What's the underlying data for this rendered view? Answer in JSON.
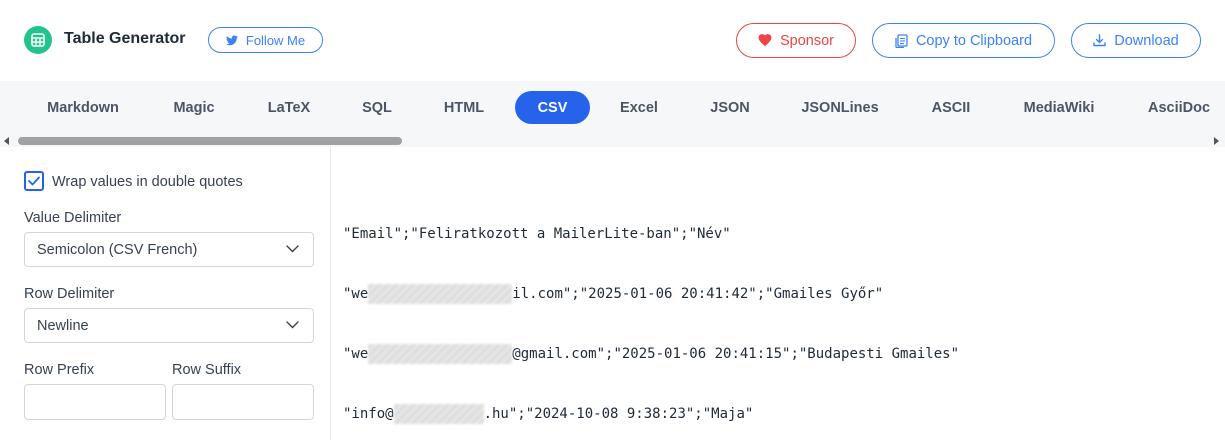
{
  "header": {
    "app_title": "Table Generator",
    "follow_label": "Follow Me",
    "sponsor_label": "Sponsor",
    "copy_label": "Copy to Clipboard",
    "download_label": "Download"
  },
  "tabs": [
    {
      "label": "Markdown"
    },
    {
      "label": "Magic"
    },
    {
      "label": "LaTeX"
    },
    {
      "label": "SQL"
    },
    {
      "label": "HTML"
    },
    {
      "label": "CSV",
      "active": true
    },
    {
      "label": "Excel"
    },
    {
      "label": "JSON"
    },
    {
      "label": "JSONLines"
    },
    {
      "label": "ASCII"
    },
    {
      "label": "MediaWiki"
    },
    {
      "label": "AsciiDoc"
    }
  ],
  "options": {
    "wrap_quotes_label": "Wrap values in double quotes",
    "wrap_quotes_checked": true,
    "value_delimiter_label": "Value Delimiter",
    "value_delimiter_value": "Semicolon (CSV French)",
    "row_delimiter_label": "Row Delimiter",
    "row_delimiter_value": "Newline",
    "row_prefix_label": "Row Prefix",
    "row_prefix_value": "",
    "row_suffix_label": "Row Suffix",
    "row_suffix_value": ""
  },
  "output": {
    "lines": [
      {
        "before": "\"Email\";\"Feliratkozott a MailerLite-ban\";\"Név\"",
        "after": ""
      },
      {
        "before": "\"we",
        "after": "il.com\";\"2025-01-06 20:41:42\";\"Gmailes Győr\""
      },
      {
        "before": "\"we",
        "after": "@gmail.com\";\"2025-01-06 20:41:15\";\"Budapesti Gmailes\""
      },
      {
        "before": "\"info@",
        "after": ".hu\";\"2024-10-08 9:38:23\";\"Maja\""
      }
    ]
  },
  "colors": {
    "accent": "#2563eb",
    "brand_green": "#22c38e",
    "sponsor_red": "#ef4444"
  }
}
